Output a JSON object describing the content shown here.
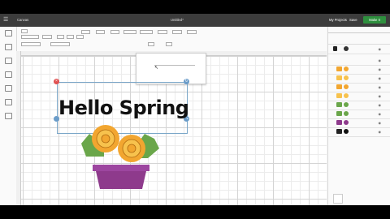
{
  "topbar": {
    "canvas_title": "Canvas",
    "doc_title": "Untitled*",
    "my_projects": "My Projects",
    "save": "Save",
    "make": "Make It"
  },
  "canvas": {
    "text": "Hello Spring"
  },
  "colors": {
    "pot": "#8e3a8c",
    "pot_rim": "#9d46a0",
    "flower": "#f2a630",
    "flower_center": "#f7c24d",
    "leaf": "#6aa64a",
    "make": "#2e8f3e",
    "handle_delete": "#e05050",
    "handle_blue": "#6a9cc9"
  },
  "icons": [
    "menu-icon",
    "close-icon",
    "rotate-icon",
    "resize-icon",
    "eye-icon"
  ]
}
